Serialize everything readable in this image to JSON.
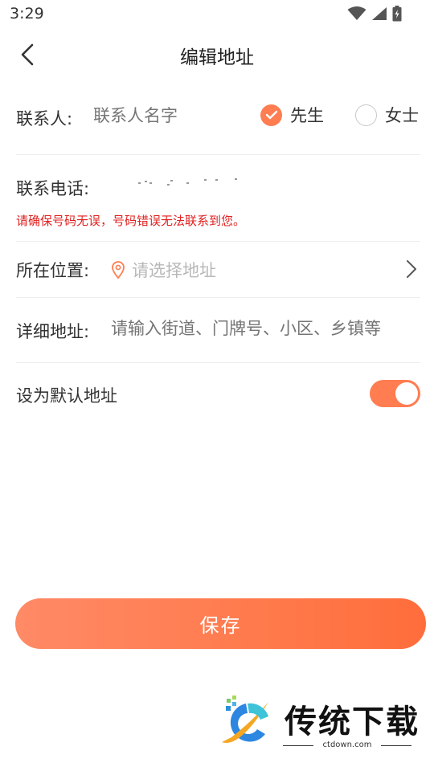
{
  "status_bar": {
    "time": "3:29"
  },
  "header": {
    "title": "编辑地址"
  },
  "contact": {
    "label": "联系人:",
    "placeholder": "联系人名字",
    "options": [
      {
        "label": "先生",
        "selected": true
      },
      {
        "label": "女士",
        "selected": false
      }
    ]
  },
  "phone": {
    "label": "联系电话:",
    "warning": "请确保号码无误，号码错误无法联系到您。"
  },
  "location": {
    "label": "所在位置:",
    "placeholder": "请选择地址"
  },
  "detail": {
    "label": "详细地址:",
    "placeholder": "请输入街道、门牌号、小区、乡镇等"
  },
  "default_address": {
    "label": "设为默认地址",
    "enabled": true
  },
  "actions": {
    "save_label": "保存"
  },
  "colors": {
    "accent": "#ff7d51",
    "warning": "#e0201f",
    "placeholder": "#b8b8b8"
  },
  "watermark": {
    "text": "传统下载",
    "sub": "ctdown.com"
  }
}
